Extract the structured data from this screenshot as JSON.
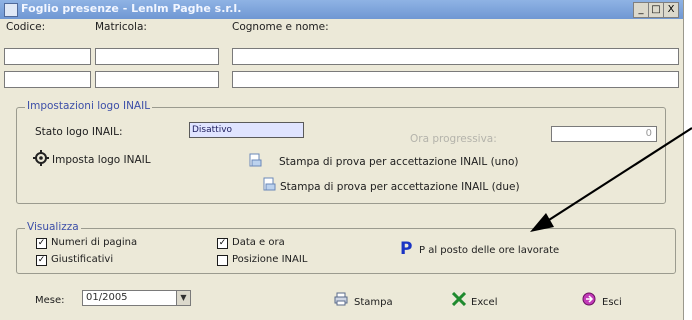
{
  "window": {
    "title": "Foglio presenze - Lenlm Paghe s.r.l.",
    "min_label": "_",
    "max_label": "□",
    "close_label": "X"
  },
  "header": {
    "codice_label": "Codice:",
    "matricola_label": "Matricola:",
    "cognome_label": "Cognome e nome:"
  },
  "inail_group": {
    "legend": "Impostazioni logo INAIL",
    "stato_label": "Stato logo INAIL:",
    "stato_value": "Disattivo",
    "progressivo_label": "Ora progressiva:",
    "progressivo_value": "0",
    "imposta_label": "Imposta logo INAIL",
    "stampa_uno_label": "Stampa di prova per accettazione INAIL (uno)",
    "stampa_due_label": "Stampa di prova per accettazione INAIL (due)"
  },
  "visualizza_group": {
    "legend": "Visualizza",
    "numeri_pagina_label": "Numeri di pagina",
    "giustificativi_label": "Giustificativi",
    "data_ora_label": "Data e ora",
    "posizione_inail_label": "Posizione INAIL",
    "p_icon_label": "P",
    "p_text": "P al posto delle ore lavorate",
    "check_mark": "✓"
  },
  "footer": {
    "mese_label": "Mese:",
    "mese_value": "01/2005",
    "combo_arrow": "▼",
    "stampa_label": "Stampa",
    "excel_label": "Excel",
    "esci_label": "Esci"
  },
  "colors": {
    "legend_blue": "#3d4fa8",
    "p_blue": "#1a34c4",
    "arrow": "#000000"
  },
  "icons": [
    "gear-icon",
    "document-icon",
    "printer-icon",
    "excel-icon",
    "exit-icon",
    "p-icon"
  ]
}
